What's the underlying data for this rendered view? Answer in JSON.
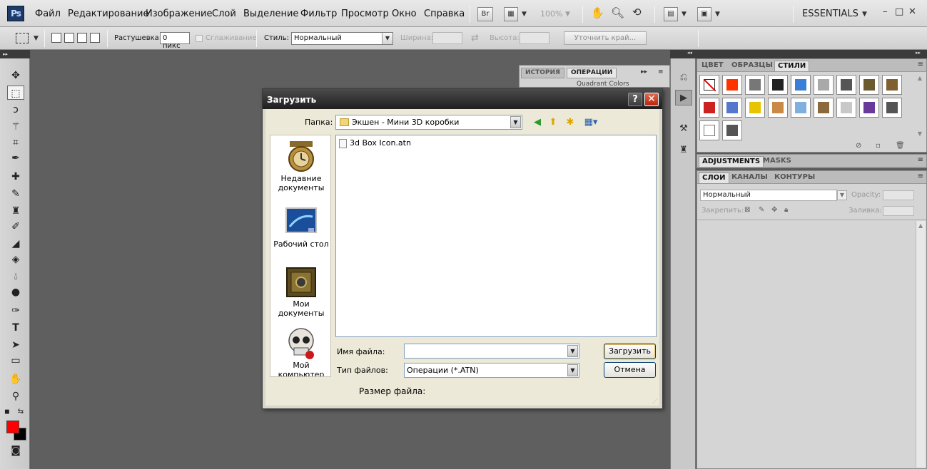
{
  "app": {
    "logo": "Ps",
    "workspace": "ESSENTIALS",
    "zoom": "100%",
    "bridge_label": "Br"
  },
  "menu": [
    "Файл",
    "Редактирование",
    "Изображение",
    "Слой",
    "Выделение",
    "Фильтр",
    "Просмотр",
    "Окно",
    "Справка"
  ],
  "options": {
    "feather_label": "Растушевка:",
    "feather_value": "0 пикс",
    "antialias_label": "Сглаживание",
    "style_label": "Стиль:",
    "style_value": "Нормальный",
    "width_label": "Ширина:",
    "height_label": "Высота:",
    "refine_label": "Уточнить край..."
  },
  "history_panel": {
    "tabs": [
      "ИСТОРИЯ",
      "ОПЕРАЦИИ"
    ],
    "row_text": "Quadrant Colors"
  },
  "styles_panel": {
    "tabs": [
      "ЦВЕТ",
      "ОБРАЗЦЫ",
      "СТИЛИ"
    ],
    "swatches": [
      "#ffffff",
      "#ff3300",
      "#777777",
      "#222222",
      "#3a7fd5",
      "#a9a9a9",
      "#555555",
      "#6b5a30",
      "#806030",
      "#cc2222",
      "#5577cc",
      "#e8c400",
      "#c88a44",
      "#7fb0e0",
      "#8a6a3c",
      "#c8c8c8",
      "#6a3a9a",
      "#555555",
      "#ffffff",
      "#555555"
    ]
  },
  "adjustments_panel": {
    "tabs": [
      "ADJUSTMENTS",
      "MASKS"
    ]
  },
  "layers_panel": {
    "tabs": [
      "СЛОИ",
      "КАНАЛЫ",
      "КОНТУРЫ"
    ],
    "blend_mode": "Нормальный",
    "opacity_label": "Opacity:",
    "lock_label": "Закрепить:",
    "fill_label": "Заливка:"
  },
  "dialog": {
    "title": "Загрузить",
    "help": "?",
    "folder_label": "Папка:",
    "folder_value": "Экшен - Мини 3D коробки",
    "places": [
      "Недавние документы",
      "Рабочий стол",
      "Мои документы",
      "Мой компьютер"
    ],
    "files": [
      "3d Box Icon.atn"
    ],
    "filename_label": "Имя файла:",
    "filename_value": "",
    "filetype_label": "Тип файлов:",
    "filetype_value": "Операции (*.ATN)",
    "filesize_label": "Размер файла:",
    "load_button": "Загрузить",
    "cancel_button": "Отмена"
  },
  "colors": {
    "foreground": "#ff0000",
    "background": "#000000"
  }
}
